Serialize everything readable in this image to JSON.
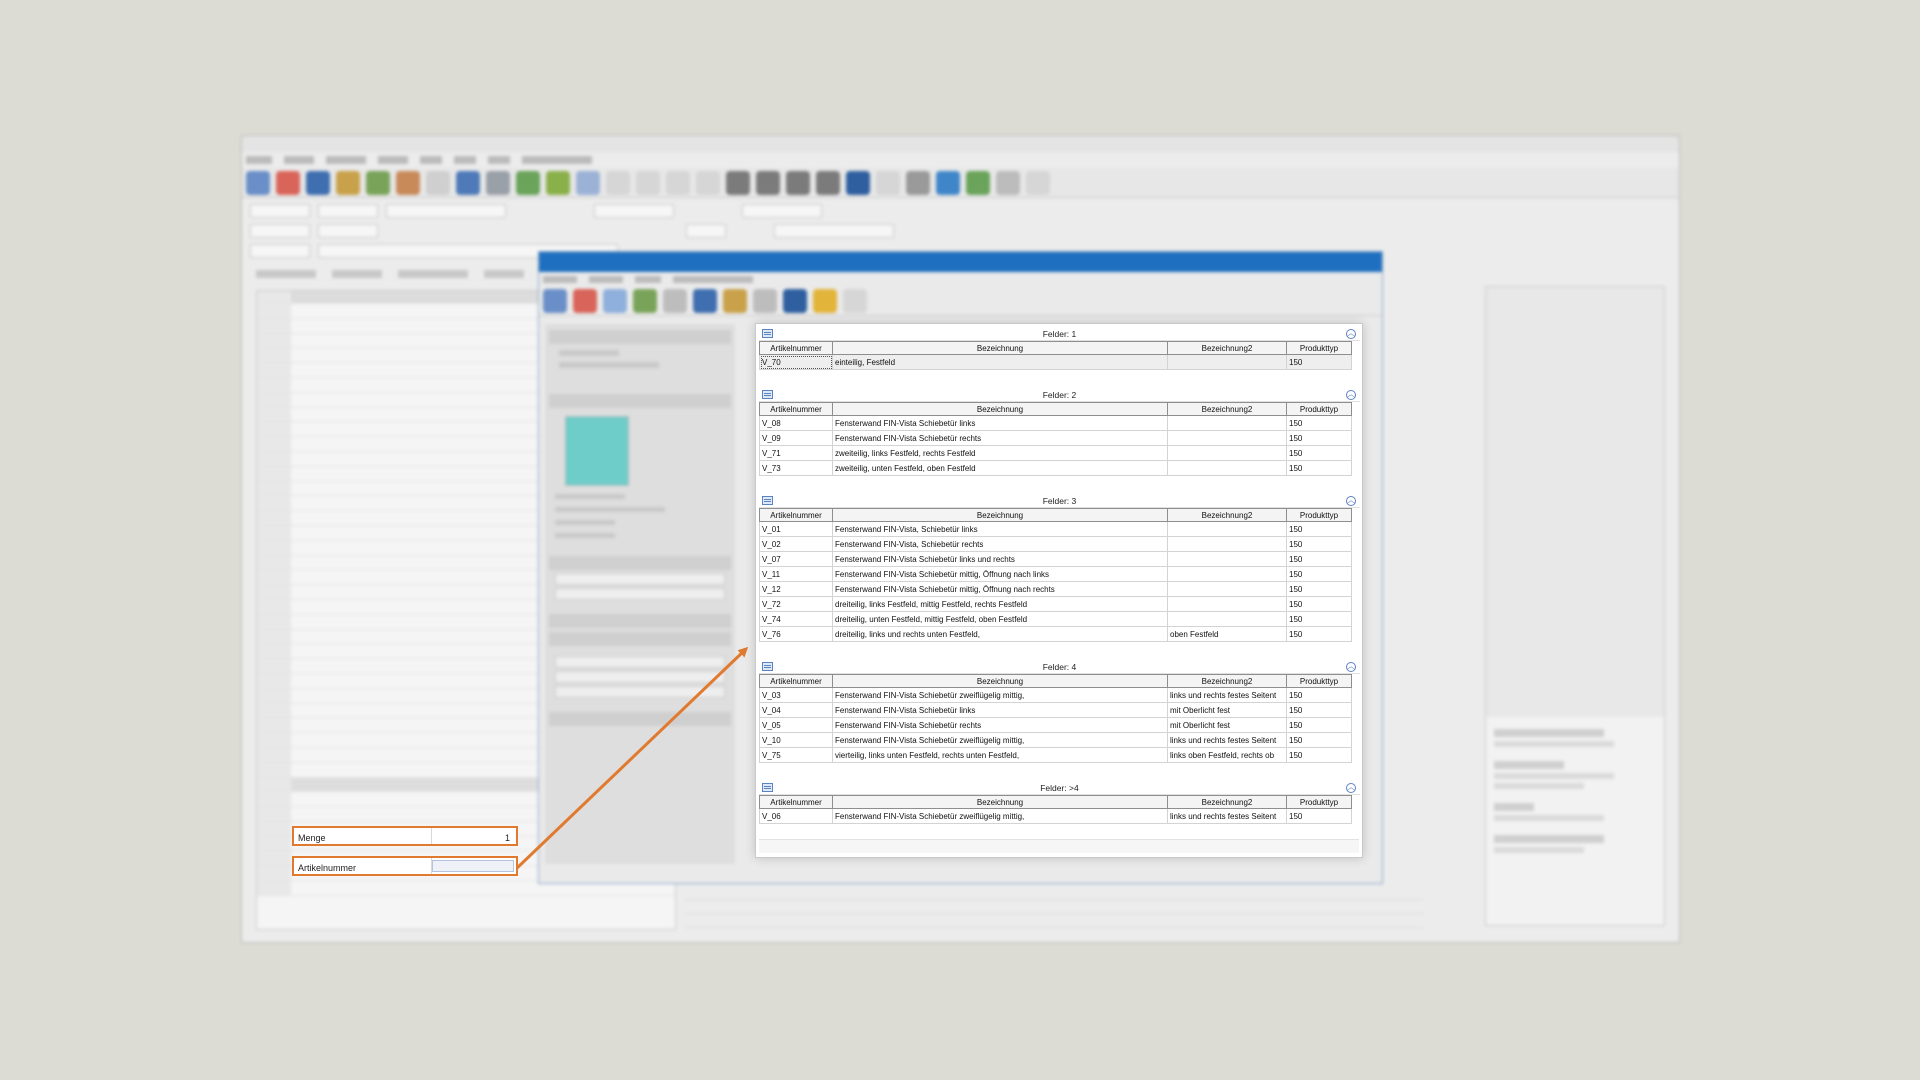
{
  "annotation": {
    "menge_label": "Menge",
    "menge_value": "1",
    "artikelnummer_label": "Artikelnummer",
    "artikelnummer_value": "",
    "color": "#e07a2e"
  },
  "popup": {
    "columns": [
      "Artikelnummer",
      "Bezeichnung",
      "Bezeichnung2",
      "Produkttyp"
    ],
    "groups": [
      {
        "title": "Felder: 1",
        "rows": [
          [
            "V_70",
            "einteilig, Festfeld",
            "",
            "150"
          ]
        ]
      },
      {
        "title": "Felder: 2",
        "rows": [
          [
            "V_08",
            "Fensterwand FIN-Vista Schiebetür links",
            "",
            "150"
          ],
          [
            "V_09",
            "Fensterwand FIN-Vista Schiebetür rechts",
            "",
            "150"
          ],
          [
            "V_71",
            "zweiteilig, links Festfeld, rechts Festfeld",
            "",
            "150"
          ],
          [
            "V_73",
            "zweiteilig, unten Festfeld, oben Festfeld",
            "",
            "150"
          ]
        ]
      },
      {
        "title": "Felder: 3",
        "rows": [
          [
            "V_01",
            "Fensterwand FIN-Vista, Schiebetür links",
            "",
            "150"
          ],
          [
            "V_02",
            "Fensterwand FIN-Vista, Schiebetür rechts",
            "",
            "150"
          ],
          [
            "V_07",
            "Fensterwand FIN-Vista Schiebetür links und rechts",
            "",
            "150"
          ],
          [
            "V_11",
            "Fensterwand FIN-Vista Schiebetür mittig, Öffnung nach links",
            "",
            "150"
          ],
          [
            "V_12",
            "Fensterwand FIN-Vista Schiebetür mittig, Öffnung nach rechts",
            "",
            "150"
          ],
          [
            "V_72",
            "dreiteilig, links Festfeld, mittig Festfeld, rechts Festfeld",
            "",
            "150"
          ],
          [
            "V_74",
            "dreiteilig, unten Festfeld, mittig Festfeld, oben Festfeld",
            "",
            "150"
          ],
          [
            "V_76",
            "dreiteilig, links und rechts unten Festfeld,",
            "oben Festfeld",
            "150"
          ]
        ]
      },
      {
        "title": "Felder: 4",
        "rows": [
          [
            "V_03",
            "Fensterwand FIN-Vista Schiebetür zweiflügelig mittig,",
            "links und rechts festes Seitent",
            "150"
          ],
          [
            "V_04",
            "Fensterwand FIN-Vista Schiebetür links",
            "mit Oberlicht fest",
            "150"
          ],
          [
            "V_05",
            "Fensterwand FIN-Vista Schiebetür rechts",
            "mit Oberlicht fest",
            "150"
          ],
          [
            "V_10",
            "Fensterwand FIN-Vista Schiebetür zweiflügelig mittig,",
            "links und rechts festes Seitent",
            "150"
          ],
          [
            "V_75",
            "vierteilig, links unten Festfeld, rechts unten Festfeld,",
            "links oben Festfeld, rechts ob",
            "150"
          ]
        ]
      },
      {
        "title": "Felder: >4",
        "rows": [
          [
            "V_06",
            "Fensterwand FIN-Vista Schiebetür zweiflügelig mittig,",
            "links und rechts festes Seitent",
            "150"
          ]
        ]
      }
    ]
  }
}
